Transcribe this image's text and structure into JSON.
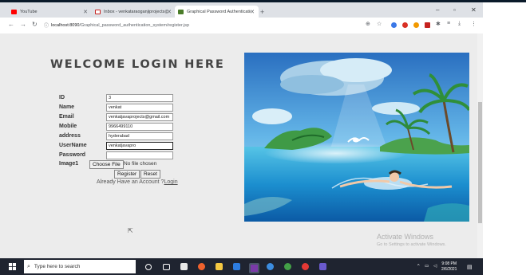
{
  "browser": {
    "tabs": [
      {
        "label": "YouTube",
        "color": "#ff0000"
      },
      {
        "label": "Inbox - venkataraoganjiprojects@gm...",
        "color": "#c5221f"
      },
      {
        "label": "Graphical Password Authentication...",
        "color": "#4a7c29"
      }
    ],
    "url_domain": "localhost:8090",
    "url_path": "/Graphical_password_authentication_system/register.jsp"
  },
  "form": {
    "heading": "WELCOME LOGIN HERE",
    "fields": [
      {
        "label": "ID",
        "value": "3"
      },
      {
        "label": "Name",
        "value": "venkat"
      },
      {
        "label": "Email",
        "value": "venkatjavaprojects@gmail.com"
      },
      {
        "label": "Mobile",
        "value": "9966499110"
      },
      {
        "label": "address",
        "value": "hyderabad"
      },
      {
        "label": "UserName",
        "value": "venkatjavapro"
      },
      {
        "label": "Password",
        "value": ""
      }
    ],
    "image_label": "Image1",
    "choose_file": "Choose File",
    "no_file": "No file chosen",
    "register": "Register",
    "reset": "Reset",
    "already": "Already Have an Account ?",
    "login": "Login"
  },
  "watermark": {
    "title": "Activate Windows",
    "subtitle": "Go to Settings to activate Windows."
  },
  "taskbar": {
    "search_placeholder": "Type here to search",
    "time": "9:08 PM",
    "date": "2/6/2021"
  }
}
